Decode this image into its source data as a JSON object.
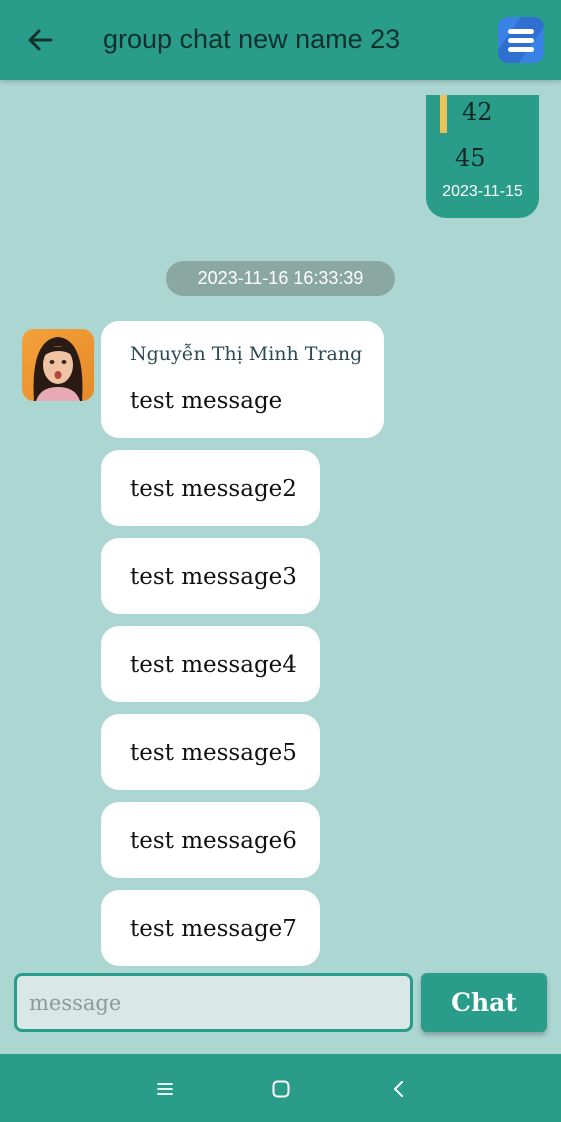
{
  "header": {
    "title": "group chat new name 23",
    "back_icon": "arrow-left-icon",
    "menu_icon": "hamburger-menu-icon"
  },
  "previous_message": {
    "reply_text": "42",
    "text": "45",
    "time": "2023-11-15"
  },
  "date_separator": "2023-11-16 16:33:39",
  "messages": [
    {
      "sender": "Nguyễn Thị Minh Trang",
      "text": "test message"
    },
    {
      "text": "test message2"
    },
    {
      "text": "test message3"
    },
    {
      "text": "test message4"
    },
    {
      "text": "test message5"
    },
    {
      "text": "test message6"
    },
    {
      "text": "test message7"
    }
  ],
  "composer": {
    "placeholder": "message",
    "value": "",
    "send_label": "Chat"
  },
  "navbar": {
    "icons": [
      "recent-apps-icon",
      "home-icon",
      "back-icon"
    ]
  },
  "colors": {
    "primary": "#2a9d8a",
    "background": "#acd6d2",
    "bubble_received": "#ffffff",
    "reply_accent": "#e8c25a",
    "menu_button": "#3b82e6"
  }
}
